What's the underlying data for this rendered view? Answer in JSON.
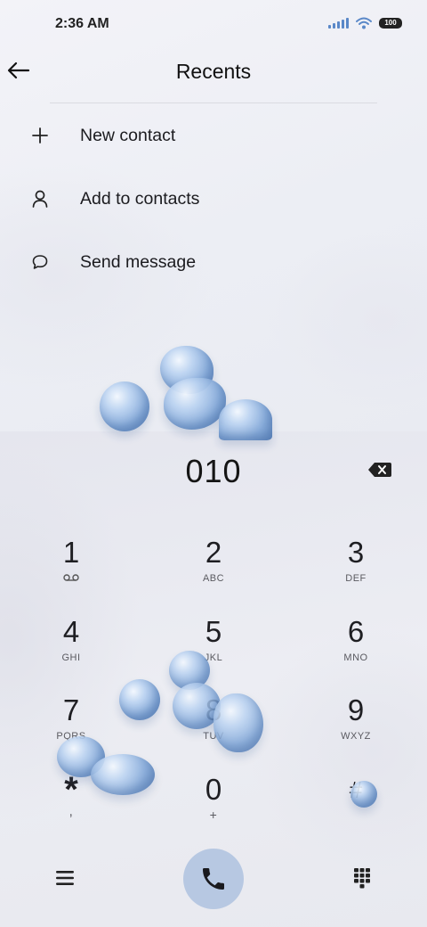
{
  "status_bar": {
    "time": "2:36 AM",
    "battery": "100",
    "icons": [
      "signal-icon",
      "wifi-icon",
      "battery-icon"
    ]
  },
  "header": {
    "title": "Recents",
    "back_icon": "arrow-left-icon"
  },
  "actions": [
    {
      "label": "New contact",
      "icon": "plus-icon"
    },
    {
      "label": "Add to contacts",
      "icon": "person-icon"
    },
    {
      "label": "Send message",
      "icon": "chat-bubble-icon"
    }
  ],
  "dialer": {
    "number": "010",
    "keys": [
      {
        "digit": "1",
        "letters": ""
      },
      {
        "digit": "2",
        "letters": "ABC"
      },
      {
        "digit": "3",
        "letters": "DEF"
      },
      {
        "digit": "4",
        "letters": "GHI"
      },
      {
        "digit": "5",
        "letters": "JKL"
      },
      {
        "digit": "6",
        "letters": "MNO"
      },
      {
        "digit": "7",
        "letters": "PQRS"
      },
      {
        "digit": "8",
        "letters": "TUV"
      },
      {
        "digit": "9",
        "letters": "WXYZ"
      },
      {
        "digit": "*",
        "letters": ","
      },
      {
        "digit": "0",
        "letters": "+"
      },
      {
        "digit": "#",
        "letters": ""
      }
    ]
  },
  "bottom_bar": {
    "left_icon": "menu-icon",
    "call_icon": "phone-icon",
    "right_icon": "keypad-icon"
  },
  "colors": {
    "call_button": "#b7c8e2",
    "signal": "#5a88c8",
    "background": "#eceef4"
  }
}
